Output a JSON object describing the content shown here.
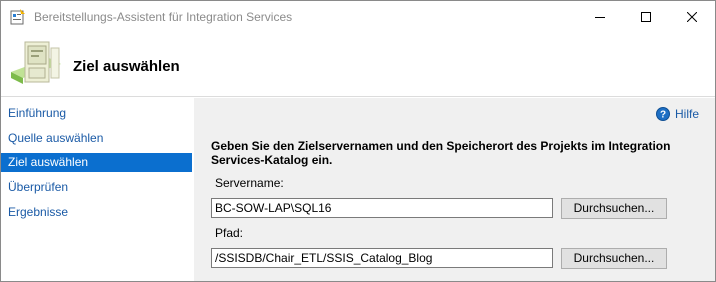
{
  "window": {
    "title": "Bereitstellungs-Assistent für Integration Services",
    "controls": [
      "minimize",
      "maximize",
      "close"
    ]
  },
  "header": {
    "title": "Ziel auswählen",
    "icon": "wizard-target-icon"
  },
  "sidebar": {
    "items": [
      {
        "label": "Einführung",
        "active": false
      },
      {
        "label": "Quelle auswählen",
        "active": false
      },
      {
        "label": "Ziel auswählen",
        "active": true
      },
      {
        "label": "Überprüfen",
        "active": false
      },
      {
        "label": "Ergebnisse",
        "active": false
      }
    ]
  },
  "main": {
    "help_label": "Hilfe",
    "instruction": "Geben Sie den Zielservernamen und den Speicherort des Projekts im Integration Services-Katalog ein.",
    "server_label": "Servername:",
    "server_value": "BC-SOW-LAP\\SQL16",
    "path_label": "Pfad:",
    "path_value": "/SSISDB/Chair_ETL/SSIS_Catalog_Blog",
    "browse_label": "Durchsuchen..."
  },
  "colors": {
    "accent": "#0b6fcf",
    "link": "#1a5aa6",
    "panel_bg": "#f0f0f0"
  }
}
